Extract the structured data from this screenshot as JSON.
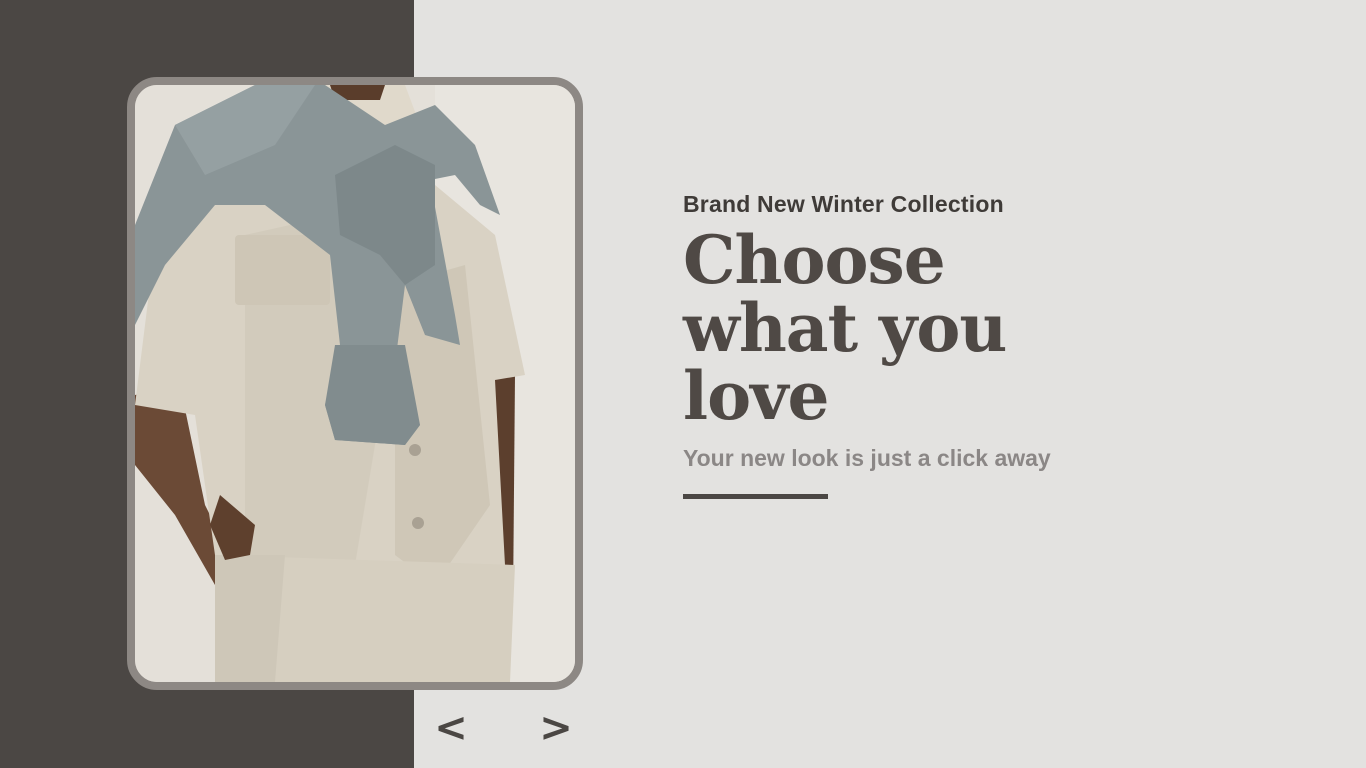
{
  "hero": {
    "eyebrow": "Brand New Winter Collection",
    "headline": "Choose what you love",
    "subline": "Your new look is just a click away"
  },
  "carousel": {
    "prev_icon": "<",
    "next_icon": ">",
    "prev_icon_name": "chevron-left-icon",
    "next_icon_name": "chevron-right-icon"
  },
  "photo": {
    "subject": "model-wearing-beige-shirt-with-grey-sweater"
  },
  "colors": {
    "dark_panel": "#4b4744",
    "light_panel": "#e3e2e0",
    "frame_border": "#8d8884",
    "headline_text": "#4f4945",
    "subline_text": "#8b8786"
  }
}
